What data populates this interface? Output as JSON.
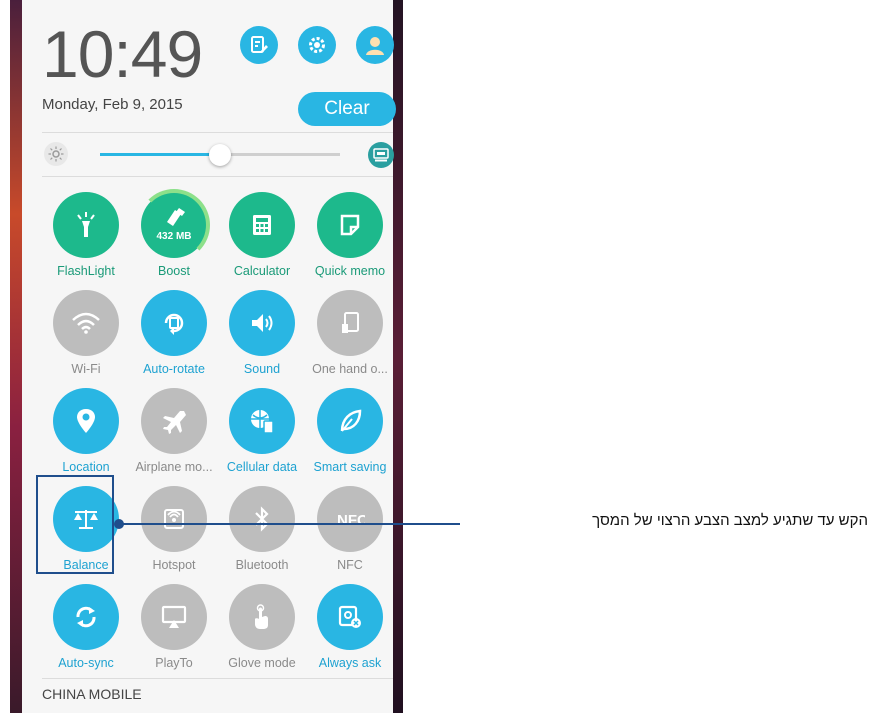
{
  "status": {
    "time": "10:49",
    "date": "Monday, Feb 9, 2015",
    "clear_label": "Clear",
    "header_icons": [
      "edit-icon",
      "settings-icon",
      "user-icon"
    ]
  },
  "brightness": {
    "level": 0.5,
    "low_icon": "sun-icon",
    "auto_icon": "auto-brightness-icon"
  },
  "tiles": [
    {
      "label": "FlashLight",
      "icon": "flashlight-icon",
      "state": "on",
      "color": "#1db98c"
    },
    {
      "label": "Boost",
      "icon": "boost-icon",
      "state": "on",
      "color": "#1db98c",
      "badge": "432 MB"
    },
    {
      "label": "Calculator",
      "icon": "calculator-icon",
      "state": "on",
      "color": "#1db98c"
    },
    {
      "label": "Quick memo",
      "icon": "memo-icon",
      "state": "on",
      "color": "#1db98c"
    },
    {
      "label": "Wi-Fi",
      "icon": "wifi-icon",
      "state": "off",
      "color": "#bdbdbd"
    },
    {
      "label": "Auto-rotate",
      "icon": "rotate-icon",
      "state": "on",
      "color": "#29b6e3"
    },
    {
      "label": "Sound",
      "icon": "sound-icon",
      "state": "on",
      "color": "#29b6e3"
    },
    {
      "label": "One hand o...",
      "icon": "one-hand-icon",
      "state": "off",
      "color": "#bdbdbd"
    },
    {
      "label": "Location",
      "icon": "location-icon",
      "state": "on",
      "color": "#29b6e3"
    },
    {
      "label": "Airplane mo...",
      "icon": "airplane-icon",
      "state": "off",
      "color": "#bdbdbd"
    },
    {
      "label": "Cellular data",
      "icon": "cellular-data-icon",
      "state": "on",
      "color": "#29b6e3"
    },
    {
      "label": "Smart saving",
      "icon": "leaf-icon",
      "state": "on",
      "color": "#29b6e3"
    },
    {
      "label": "Balance",
      "icon": "balance-icon",
      "state": "on",
      "color": "#29b6e3"
    },
    {
      "label": "Hotspot",
      "icon": "hotspot-icon",
      "state": "off",
      "color": "#bdbdbd"
    },
    {
      "label": "Bluetooth",
      "icon": "bluetooth-icon",
      "state": "off",
      "color": "#bdbdbd"
    },
    {
      "label": "NFC",
      "icon": "nfc-icon",
      "state": "off",
      "color": "#bdbdbd"
    },
    {
      "label": "Auto-sync",
      "icon": "sync-icon",
      "state": "on",
      "color": "#29b6e3"
    },
    {
      "label": "PlayTo",
      "icon": "playto-icon",
      "state": "off",
      "color": "#bdbdbd"
    },
    {
      "label": "Glove mode",
      "icon": "glove-icon",
      "state": "off",
      "color": "#bdbdbd"
    },
    {
      "label": "Always ask",
      "icon": "always-ask-icon",
      "state": "on",
      "color": "#29b6e3"
    }
  ],
  "carrier": "CHINA MOBILE",
  "callout": {
    "text": "הקש עד שתגיע למצב הצבע הרצוי של המסך"
  }
}
